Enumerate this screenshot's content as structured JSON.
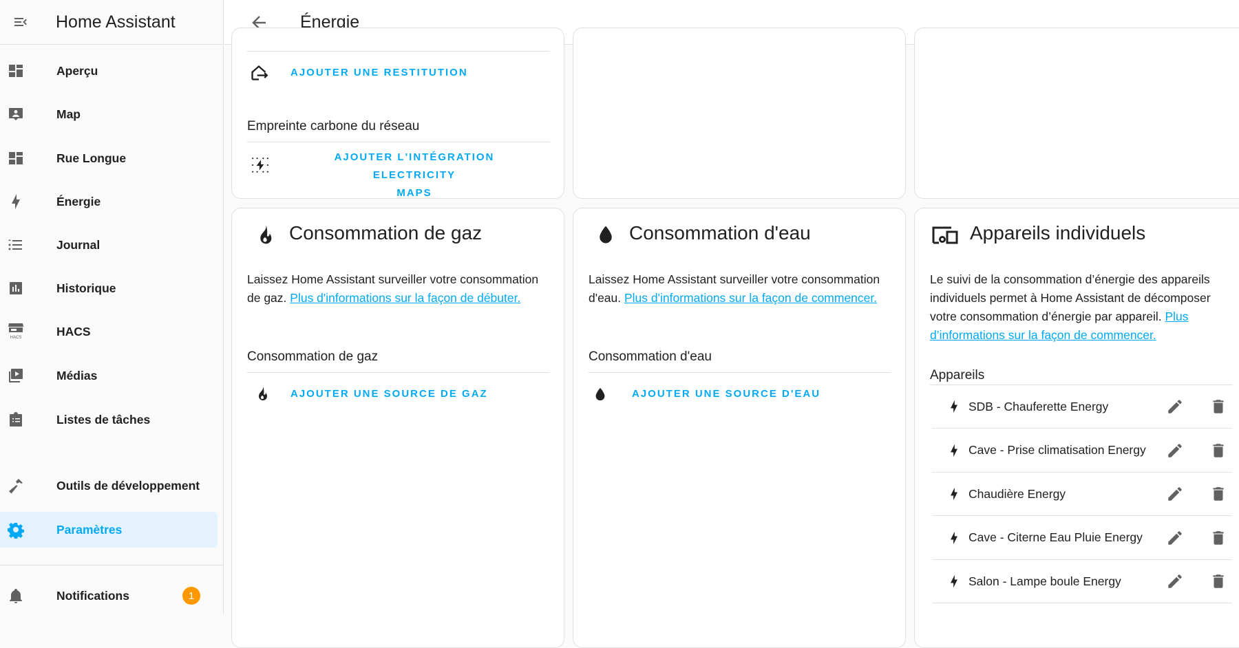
{
  "sidebar": {
    "title": "Home Assistant",
    "items": [
      {
        "label": "Aperçu",
        "icon": "view-dashboard-icon"
      },
      {
        "label": "Map",
        "icon": "map-account-icon"
      },
      {
        "label": "Rue Longue",
        "icon": "view-dashboard-icon"
      },
      {
        "label": "Énergie",
        "icon": "lightning-bolt-icon"
      },
      {
        "label": "Journal",
        "icon": "format-list-bulleted-icon"
      },
      {
        "label": "Historique",
        "icon": "chart-box-icon"
      },
      {
        "label": "HACS",
        "icon": "hacs-icon"
      },
      {
        "label": "Médias",
        "icon": "play-box-multiple-icon"
      },
      {
        "label": "Listes de tâches",
        "icon": "clipboard-list-icon"
      }
    ],
    "dev_tools": "Outils de développement",
    "settings": "Paramètres",
    "notifications": "Notifications",
    "notifications_count": "1",
    "hacs_icon_text": "HACS"
  },
  "header": {
    "title": "Énergie"
  },
  "grid_card": {
    "return_button": "AJOUTER UNE RESTITUTION",
    "carbon_heading": "Empreinte carbone du réseau",
    "carbon_button_line1": "AJOUTER L'INTÉGRATION ELECTRICITY",
    "carbon_button_line2": "MAPS"
  },
  "gas_card": {
    "title": "Consommation de gaz",
    "desc": "Laissez Home Assistant surveiller votre consommation de gaz. ",
    "link": "Plus d'informations sur la façon de débuter.",
    "subheading": "Consommation de gaz",
    "button": "AJOUTER UNE SOURCE DE GAZ"
  },
  "water_card": {
    "title": "Consommation d'eau",
    "desc": "Laissez Home Assistant surveiller votre consommation d'eau. ",
    "link": "Plus d'informations sur la façon de commencer.",
    "subheading": "Consommation d'eau",
    "button": "AJOUTER UNE SOURCE D'EAU"
  },
  "devices_card": {
    "title": "Appareils individuels",
    "desc": "Le suivi de la consommation d’énergie des appareils individuels permet à Home Assistant de décomposer votre consommation d’énergie par appareil. ",
    "link": "Plus d’informations sur la façon de commencer.",
    "subheading": "Appareils",
    "devices": [
      "SDB - Chauferette Energy",
      "Cave - Prise climatisation Energy",
      "Chaudière Energy",
      "Cave - Citerne Eau Pluie Energy",
      "Salon - Lampe boule Energy"
    ]
  },
  "colors": {
    "accent": "#03a9f4",
    "badge": "#ff9800",
    "icon": "#616161"
  }
}
